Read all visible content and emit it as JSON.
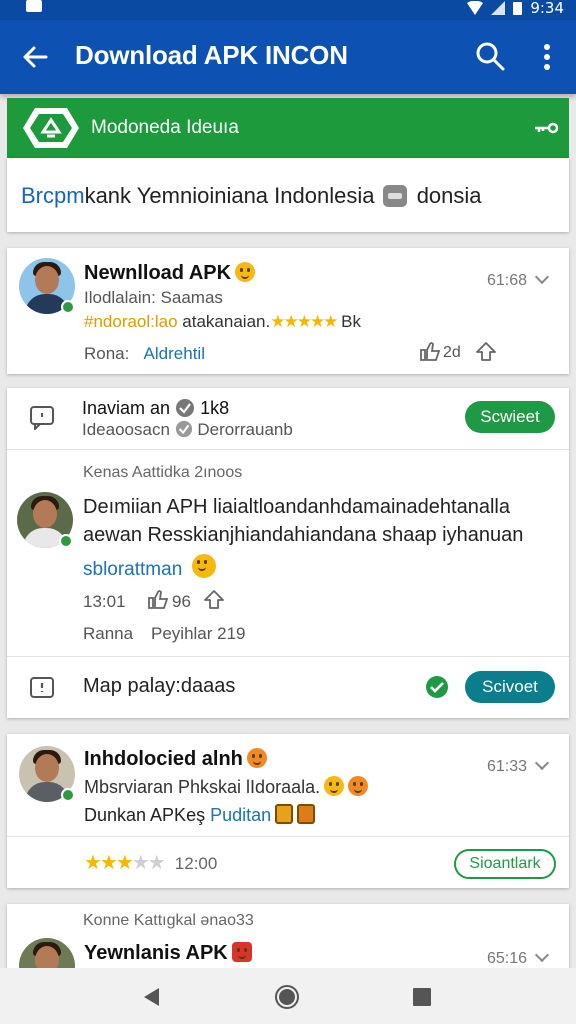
{
  "status_bar": {
    "time": "9:34"
  },
  "app_bar": {
    "title": "Download APK INCON"
  },
  "banner": {
    "label": "Modoneda Ideuıa"
  },
  "header_line": {
    "part1": "Brcpm",
    "part2": "kank Yemnioiniana  Indonlesia ",
    "part3": " donsia"
  },
  "post1": {
    "name": "Newnlload APK",
    "subtitle": "Ilodlalain: Saamas",
    "rating_prefix": "#ndoraol:lao",
    "rating_text": " atakanaian.",
    "rating_suffix": " Bk",
    "stars": "★★★★★",
    "time": "61:68",
    "footer_label": "Rona:",
    "footer_link": "Aldrehtil",
    "like_count": "2d"
  },
  "post2": {
    "title": "Inaviam an",
    "title_count": "1k8",
    "subtitle_a": "Ideaoosacn",
    "subtitle_b": "Derorrauanb",
    "button": "Scwieet",
    "section_label": "Kenas Aattidka 2ınoos",
    "body_line1": "Deımiian APH liaialtloandanhdamainadehtanalla",
    "body_line2": "aewan Resskianjhiandahiandana shaap iyhanuan",
    "body_link": "sblorattman",
    "time": "13:01",
    "like_count": "96",
    "footer_label": "Ranna",
    "footer_value": "Peyihlar 219",
    "map_text": "Map palay:daaas",
    "map_button": "Scivoet"
  },
  "post3": {
    "name": "Inhdolocied alnh",
    "subtitle": "Mbsrviaran Phkskai lIdoraala.",
    "line3_text": "Dunkan APKeş ",
    "line3_link": "Puditan",
    "time": "61:33",
    "stars_on": "★★★",
    "stars_off": "★★",
    "rating_time": "12:00",
    "button": "Sioantlark"
  },
  "post4": {
    "section_label": "Konne Kattıgkal ənao33",
    "name": "Yewnlanis APK",
    "time": "65:16"
  },
  "colors": {
    "app_bar": "#0d52b3",
    "banner": "#1d9a3c",
    "accent_green": "#1f9a44",
    "accent_teal": "#0a7e8c",
    "link": "#1a73b8",
    "star": "#f5b800"
  }
}
